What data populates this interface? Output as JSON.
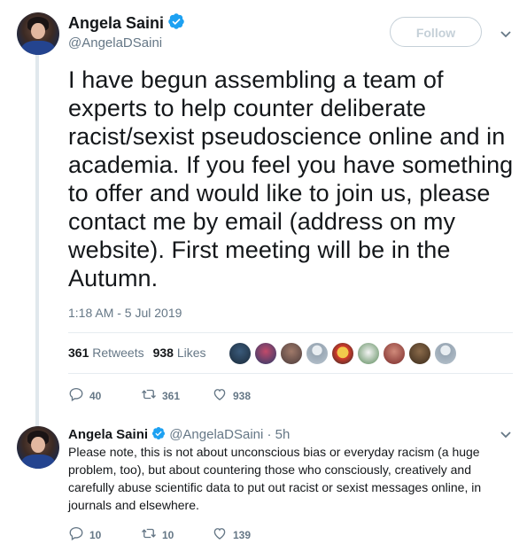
{
  "tweet": {
    "author_name": "Angela Saini",
    "author_handle": "@AngelaDSaini",
    "follow_label": "Follow",
    "text": "I have begun assembling a team of experts to help counter deliberate racist/sexist pseudoscience online and in academia. If you feel you have something to offer and would like to join us, please contact me by email (address on my website). First meeting will be in the Autumn.",
    "timestamp": "1:18 AM - 5 Jul 2019",
    "retweets_count": "361",
    "retweets_label": "Retweets",
    "likes_count": "938",
    "likes_label": "Likes",
    "actions": {
      "replies": "40",
      "retweets": "361",
      "likes": "938"
    }
  },
  "reply": {
    "author_name": "Angela Saini",
    "author_handle": "@AngelaDSaini",
    "time": "· 5h",
    "text": "Please note, this is not about unconscious bias or everyday racism (a huge problem, too), but about countering those who consciously, creatively and carefully abuse scientific data to put out racist or sexist messages online, in journals and elsewhere.",
    "actions": {
      "replies": "10",
      "retweets": "10",
      "likes": "139"
    }
  },
  "colors": {
    "verified": "#1da1f2",
    "muted_text": "#657786",
    "divider": "#e6ecf0",
    "follow_border": "#c5d0d8"
  },
  "icons": [
    "verified-icon",
    "chevron-down-icon",
    "reply-icon",
    "retweet-icon",
    "like-icon"
  ],
  "liker_avatar_count": 9
}
